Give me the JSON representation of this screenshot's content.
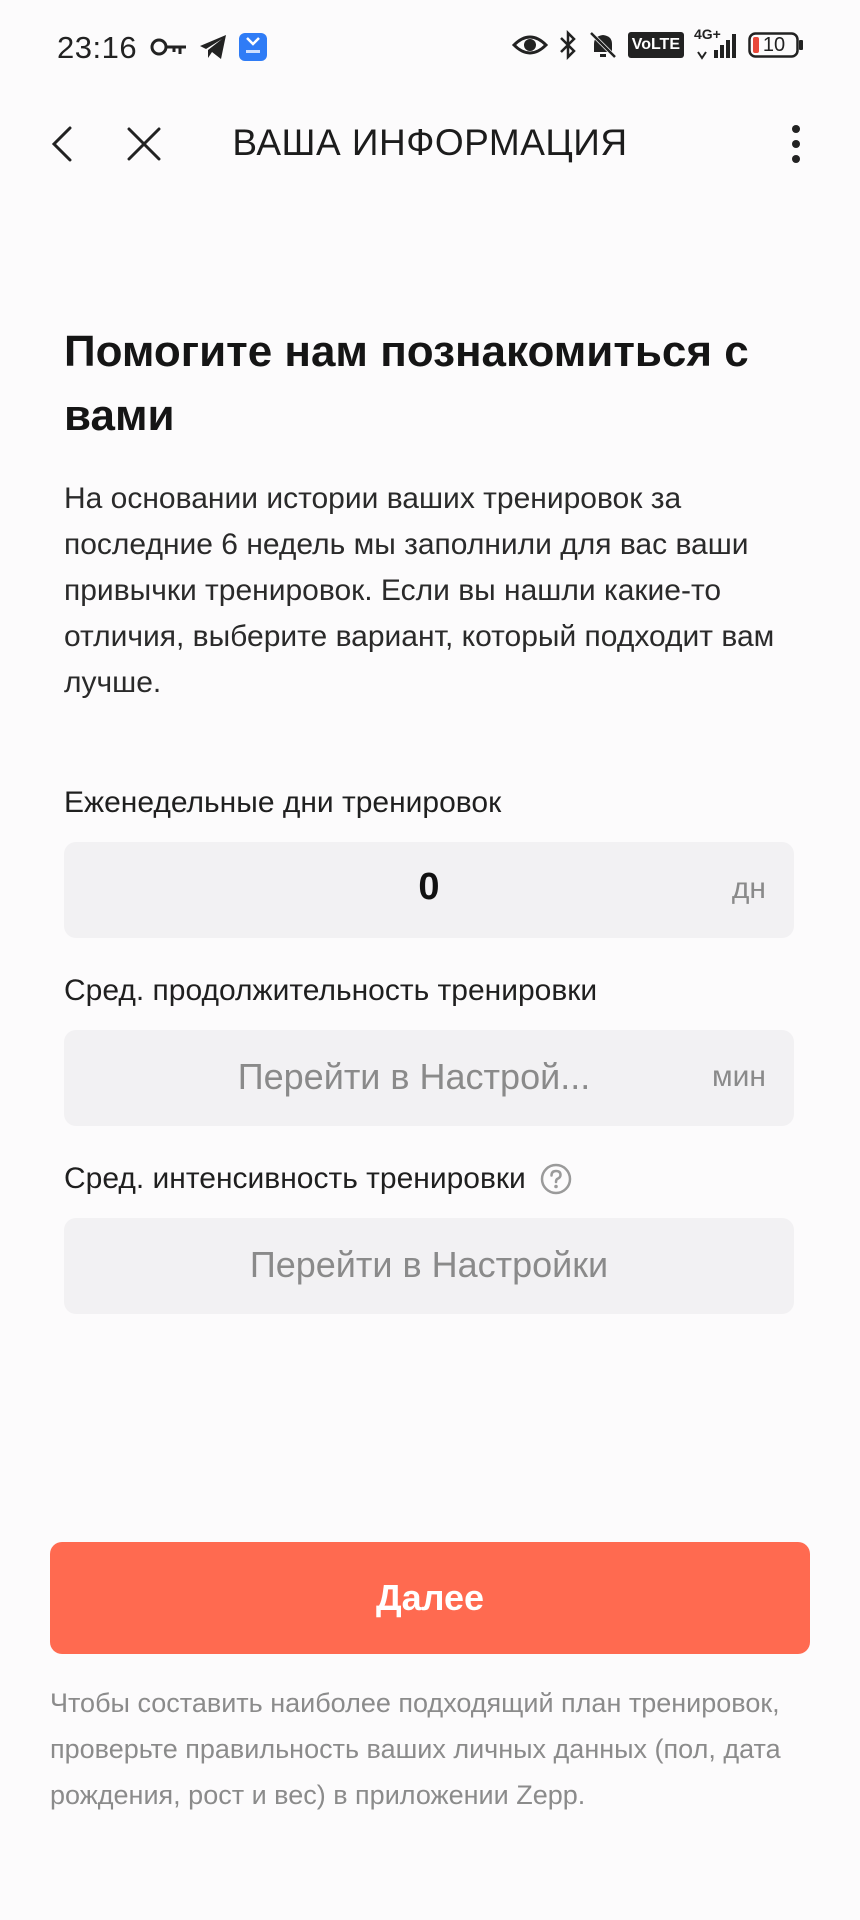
{
  "status_bar": {
    "time": "23:16",
    "volte": "VoLTE",
    "network": "4G+",
    "battery": "10",
    "left_icons": [
      "key-icon",
      "telegram-icon",
      "app-icon"
    ],
    "right_icons": [
      "eye-icon",
      "bluetooth-icon",
      "mute-icon",
      "volte-icon",
      "signal-icon",
      "battery-icon"
    ]
  },
  "nav": {
    "title": "ВАША ИНФОРМАЦИЯ"
  },
  "intro": {
    "headline": "Помогите нам познакомиться с вами",
    "description": "На основании истории ваших тренировок за последние 6 недель мы заполнили для вас ваши привычки тренировок. Если вы нашли какие-то отличия, выберите вариант, который подходит вам лучше."
  },
  "fields": {
    "weekly_days": {
      "label": "Еженедельные дни тренировок",
      "value": "0",
      "unit": "дн"
    },
    "avg_duration": {
      "label": "Сред. продолжительность тренировки",
      "value": "Перейти в Настрой...",
      "unit": "мин"
    },
    "avg_intensity": {
      "label": "Сред. интенсивность тренировки",
      "value": "Перейти в Настройки"
    }
  },
  "next_button": "Далее",
  "footnote": "Чтобы составить наиболее подходящий план тренировок, проверьте правильность ваших личных данных (пол, дата рождения, рост и вес) в приложении Zepp.",
  "colors": {
    "accent": "#ff6a50",
    "field_bg": "#f2f1f3",
    "muted_text": "#8a8a8a"
  }
}
